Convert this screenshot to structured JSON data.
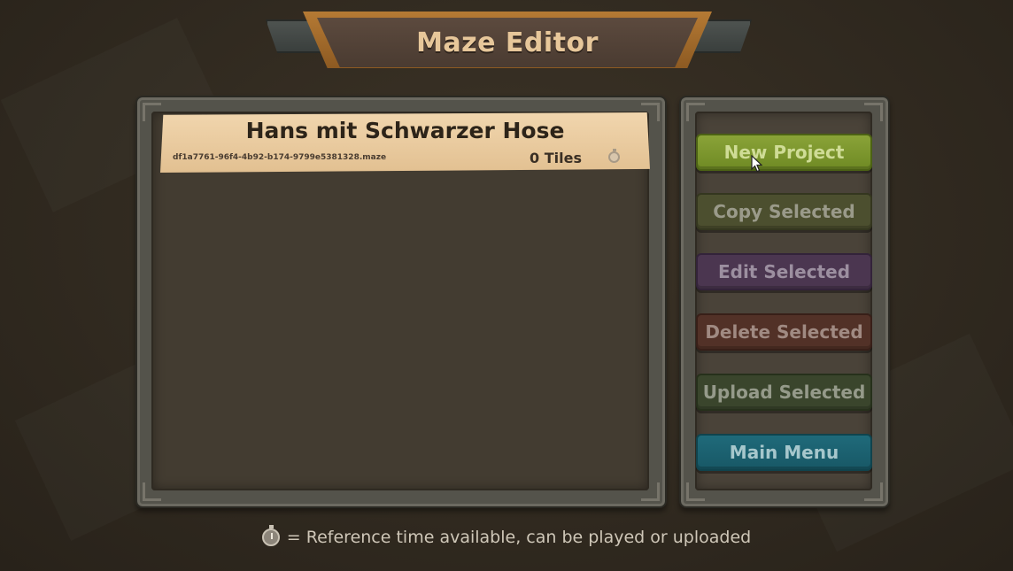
{
  "title": "Maze Editor",
  "projects": [
    {
      "name": "Hans mit Schwarzer Hose",
      "file": "df1a7761-96f4-4b92-b174-9799e5381328.maze",
      "tiles": "0 Tiles",
      "icon": "stopwatch-icon"
    }
  ],
  "buttons": {
    "new_project": "New Project",
    "copy_selected": "Copy Selected",
    "edit_selected": "Edit Selected",
    "delete_selected": "Delete Selected",
    "upload_selected": "Upload Selected",
    "main_menu": "Main Menu"
  },
  "footer": {
    "icon": "stopwatch-icon",
    "text": "= Reference time available, can be played or uploaded"
  },
  "colors": {
    "new_project": "#7d9630",
    "copy_selected": "#4c4f2f",
    "edit_selected": "#4b3650",
    "delete_selected": "#523127",
    "upload_selected": "#3a452c",
    "main_menu": "#1d6373",
    "title_text": "#e7c79a"
  }
}
